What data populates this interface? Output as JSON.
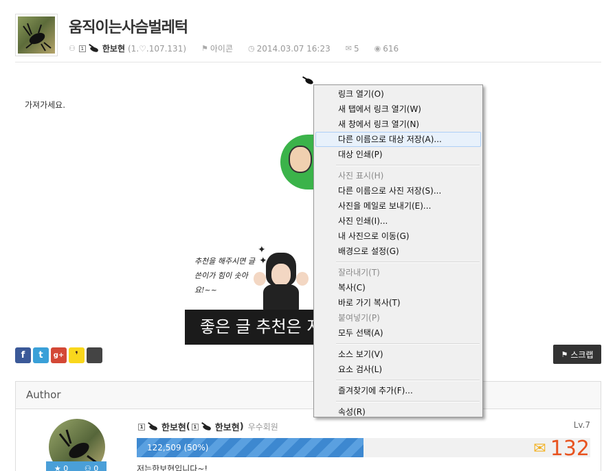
{
  "post": {
    "title": "움직이는사슴벌레턱",
    "author": "한보현",
    "author_ip": "(1.♡.107.131)",
    "level_badge": "1",
    "category": "아이콘",
    "datetime": "2014.03.07 16:23",
    "comments": "5",
    "views": "616",
    "body": "가져가세요."
  },
  "promo": {
    "note": "추천을 해주시면 글쓴이가 힘이 솟아요!~~",
    "banner": "좋은 글 추천은 저"
  },
  "share": {
    "facebook": "f",
    "twitter": "t",
    "googleplus": "g+",
    "kakaostory": "❜",
    "scrap_label": "스크랩"
  },
  "author_box": {
    "heading": "Author",
    "name": "한보현",
    "nick": "한보현",
    "grade": "우수회원",
    "level": "Lv.7",
    "xp_label": "122,509 (50%)",
    "xp_percent": 50,
    "post_count": "132",
    "bio": "저는한보현입니다~!",
    "stat_recommend": "0",
    "stat_follow": "0"
  },
  "context_menu": {
    "groups": [
      [
        {
          "label": "링크 열기(O)",
          "disabled": false
        },
        {
          "label": "새 탭에서 링크 열기(W)",
          "disabled": false
        },
        {
          "label": "새 창에서 링크 열기(N)",
          "disabled": false
        },
        {
          "label": "다른 이름으로 대상 저장(A)...",
          "disabled": false,
          "hover": true
        },
        {
          "label": "대상 인쇄(P)",
          "disabled": false
        }
      ],
      [
        {
          "label": "사진 표시(H)",
          "disabled": true
        },
        {
          "label": "다른 이름으로 사진 저장(S)...",
          "disabled": false
        },
        {
          "label": "사진을 메일로 보내기(E)...",
          "disabled": false
        },
        {
          "label": "사진 인쇄(I)...",
          "disabled": false
        },
        {
          "label": "내 사진으로 이동(G)",
          "disabled": false
        },
        {
          "label": "배경으로 설정(G)",
          "disabled": false
        }
      ],
      [
        {
          "label": "잘라내기(T)",
          "disabled": true
        },
        {
          "label": "복사(C)",
          "disabled": false
        },
        {
          "label": "바로 가기 복사(T)",
          "disabled": false
        },
        {
          "label": "붙여넣기(P)",
          "disabled": true
        },
        {
          "label": "모두 선택(A)",
          "disabled": false
        }
      ],
      [
        {
          "label": "소스 보기(V)",
          "disabled": false
        },
        {
          "label": "요소 검사(L)",
          "disabled": false
        }
      ],
      [
        {
          "label": "즐겨찾기에 추가(F)...",
          "disabled": false
        }
      ],
      [
        {
          "label": "속성(R)",
          "disabled": false
        }
      ]
    ]
  }
}
